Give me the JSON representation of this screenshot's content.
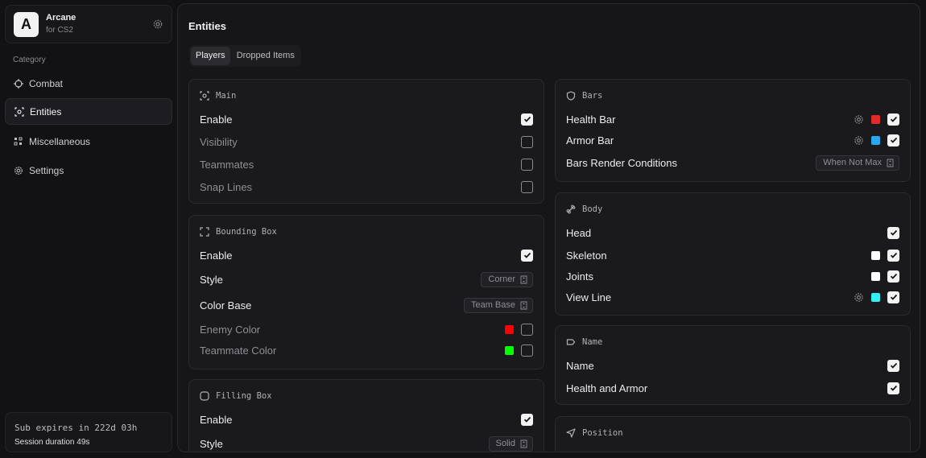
{
  "brand": {
    "logo_letter": "A",
    "name": "Arcane",
    "subtitle": "for CS2"
  },
  "sidebar": {
    "category_label": "Category",
    "items": [
      {
        "label": "Combat",
        "icon": "crosshair-icon",
        "active": false
      },
      {
        "label": "Entities",
        "icon": "entity-icon",
        "active": true
      },
      {
        "label": "Miscellaneous",
        "icon": "grid-icon",
        "active": false
      },
      {
        "label": "Settings",
        "icon": "gear-icon",
        "active": false
      }
    ],
    "subscription": {
      "expires": "Sub expires in 222d 03h",
      "session": "Session duration 49s"
    }
  },
  "main": {
    "title": "Entities",
    "tabs": [
      {
        "label": "Players",
        "active": true
      },
      {
        "label": "Dropped Items",
        "active": false
      }
    ]
  },
  "cards": {
    "main": {
      "title": "Main",
      "rows": [
        {
          "label": "Enable",
          "checked": true
        },
        {
          "label": "Visibility",
          "checked": false
        },
        {
          "label": "Teammates",
          "checked": false
        },
        {
          "label": "Snap Lines",
          "checked": false
        }
      ]
    },
    "bounding_box": {
      "title": "Bounding Box",
      "enable": "Enable",
      "style_label": "Style",
      "style_value": "Corner",
      "color_base_label": "Color Base",
      "color_base_value": "Team Base",
      "enemy_color": "Enemy Color",
      "teammate_color": "Teammate Color"
    },
    "filling_box": {
      "title": "Filling Box",
      "enable": "Enable",
      "style_label": "Style",
      "style_value": "Solid"
    },
    "bars": {
      "title": "Bars",
      "health_bar": "Health Bar",
      "armor_bar": "Armor Bar",
      "render_label": "Bars Render Conditions",
      "render_value": "When Not Max"
    },
    "body": {
      "title": "Body",
      "head": "Head",
      "skeleton": "Skeleton",
      "joints": "Joints",
      "view_line": "View Line"
    },
    "name": {
      "title": "Name",
      "name": "Name",
      "health_armor": "Health and Armor"
    },
    "position": {
      "title": "Position"
    }
  },
  "colors": {
    "enemy": "#ff0000",
    "teammate": "#00ff00",
    "health": "#e12a2a",
    "armor": "#2aa7f0",
    "white": "#ffffff",
    "view_line": "#33f0f5"
  }
}
